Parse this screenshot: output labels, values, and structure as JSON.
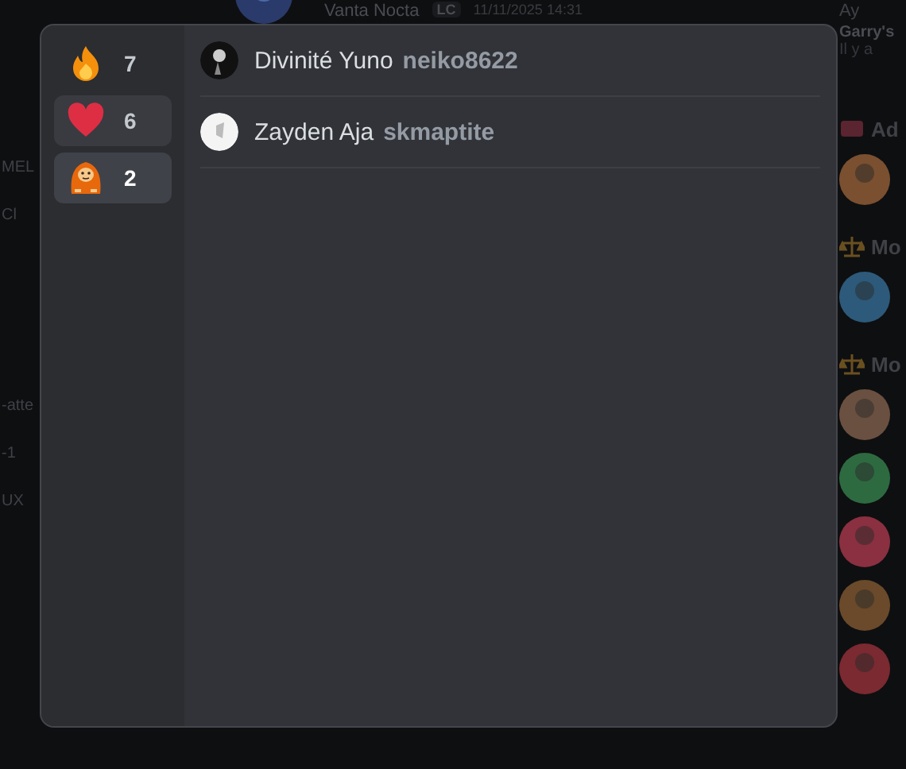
{
  "background": {
    "message_header": {
      "author": "Vanta Nocta",
      "tag": "LC",
      "time": "11/11/2025 14:31"
    },
    "left_fragments": [
      "MEL",
      "Cl",
      "-atte",
      "-1",
      "UX"
    ],
    "member_list": {
      "top_name": "Ay",
      "game_title": "Garry's",
      "activity": "Il y a",
      "groups": [
        {
          "kind": "admin",
          "label": "Ad"
        },
        {
          "kind": "moderator",
          "label": "Mo"
        },
        {
          "kind": "moderator",
          "label": "Mo"
        }
      ]
    }
  },
  "reactions": [
    {
      "kind": "fire",
      "count": "7",
      "selected": false,
      "hovered": false
    },
    {
      "kind": "heart",
      "count": "6",
      "selected": false,
      "hovered": true
    },
    {
      "kind": "orangutan",
      "count": "2",
      "selected": true,
      "hovered": false
    }
  ],
  "users": [
    {
      "display_name": "Divinité Yuno",
      "username": "neiko8622"
    },
    {
      "display_name": "Zayden Aja",
      "username": "skmaptite"
    }
  ]
}
